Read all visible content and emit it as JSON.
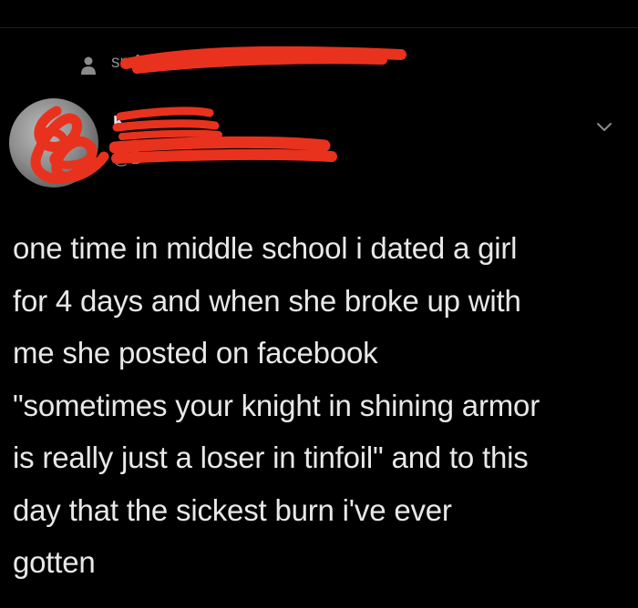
{
  "context": {
    "text": "sn                    follow",
    "icon": "person-icon"
  },
  "user": {
    "display_name": "K",
    "handle": "@B",
    "avatar_icon": "avatar-redacted"
  },
  "menu": {
    "icon": "chevron-down-icon"
  },
  "tweet": {
    "text": "one time in middle school i dated a girl\nfor 4 days and when she broke up with\nme she posted on facebook\n\"sometimes your knight in shining armor\nis really just a loser in tinfoil\" and to this\nday that the sickest burn i've ever\ngotten"
  },
  "colors": {
    "background": "#000000",
    "primary_text": "#e8e8e8",
    "secondary_text": "#8b8b8b",
    "redaction": "#e8321e"
  }
}
